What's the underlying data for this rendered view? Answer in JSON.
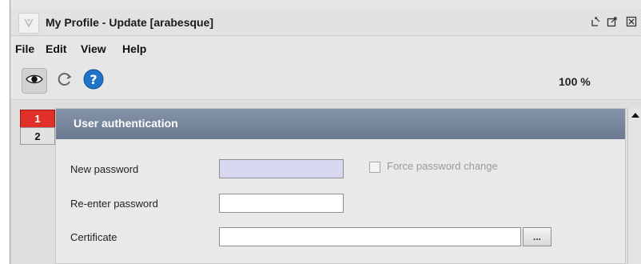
{
  "window": {
    "title": "My Profile - Update [arabesque]"
  },
  "menu": {
    "items": [
      "File",
      "Edit",
      "View",
      "Help"
    ]
  },
  "toolbar": {
    "buttons": [
      {
        "icon": "eye-icon"
      },
      {
        "icon": "refresh-icon"
      },
      {
        "icon": "help-icon"
      }
    ],
    "zoom": "100 %"
  },
  "tabs": [
    {
      "label": "1",
      "active": true
    },
    {
      "label": "2",
      "active": false
    }
  ],
  "section": {
    "title": "User authentication"
  },
  "form": {
    "new_password_label": "New password",
    "new_password_value": "",
    "force_change_label": "Force password change",
    "force_change_checked": false,
    "reenter_password_label": "Re-enter password",
    "reenter_password_value": "",
    "certificate_label": "Certificate",
    "certificate_value": "",
    "browse_label": "..."
  },
  "colors": {
    "active_tab": "#e0302a",
    "section_header": "#7584a0",
    "focused_input": "#d7d7f0",
    "help_icon": "#1f73c8"
  }
}
